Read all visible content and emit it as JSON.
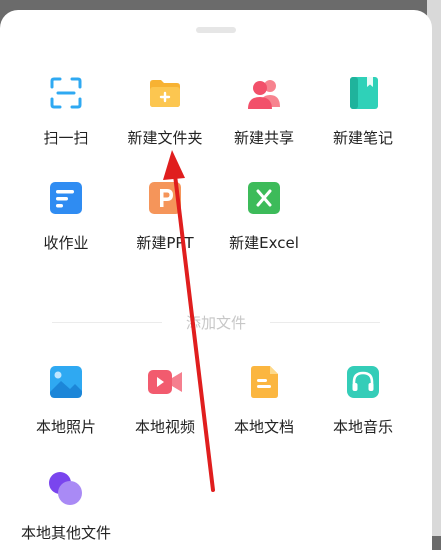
{
  "actions_row1": [
    {
      "label": "扫一扫",
      "icon": "scan-icon"
    },
    {
      "label": "新建文件夹",
      "icon": "folder-plus-icon"
    },
    {
      "label": "新建共享",
      "icon": "share-people-icon"
    },
    {
      "label": "新建笔记",
      "icon": "note-icon"
    }
  ],
  "actions_row2": [
    {
      "label": "收作业",
      "icon": "homework-icon"
    },
    {
      "label": "新建PPT",
      "icon": "ppt-icon"
    },
    {
      "label": "新建Excel",
      "icon": "excel-icon"
    }
  ],
  "section_title": "添加文件",
  "files_row1": [
    {
      "label": "本地照片",
      "icon": "photo-icon"
    },
    {
      "label": "本地视频",
      "icon": "video-icon"
    },
    {
      "label": "本地文档",
      "icon": "document-icon"
    },
    {
      "label": "本地音乐",
      "icon": "music-icon"
    }
  ],
  "files_row2": [
    {
      "label": "本地其他文件",
      "icon": "other-files-icon"
    }
  ],
  "colors": {
    "accent_blue": "#2fa9f2",
    "folder_orange": "#f7b233",
    "share_red": "#f2506a",
    "note_teal": "#2fd1b8",
    "ppt_orange": "#f5955a",
    "excel_green": "#3dbb5a",
    "video_red": "#f25b6e",
    "music_teal": "#34cdb8",
    "other_purple": "#8a5cf0",
    "annotation_arrow": "#e01e1e"
  }
}
